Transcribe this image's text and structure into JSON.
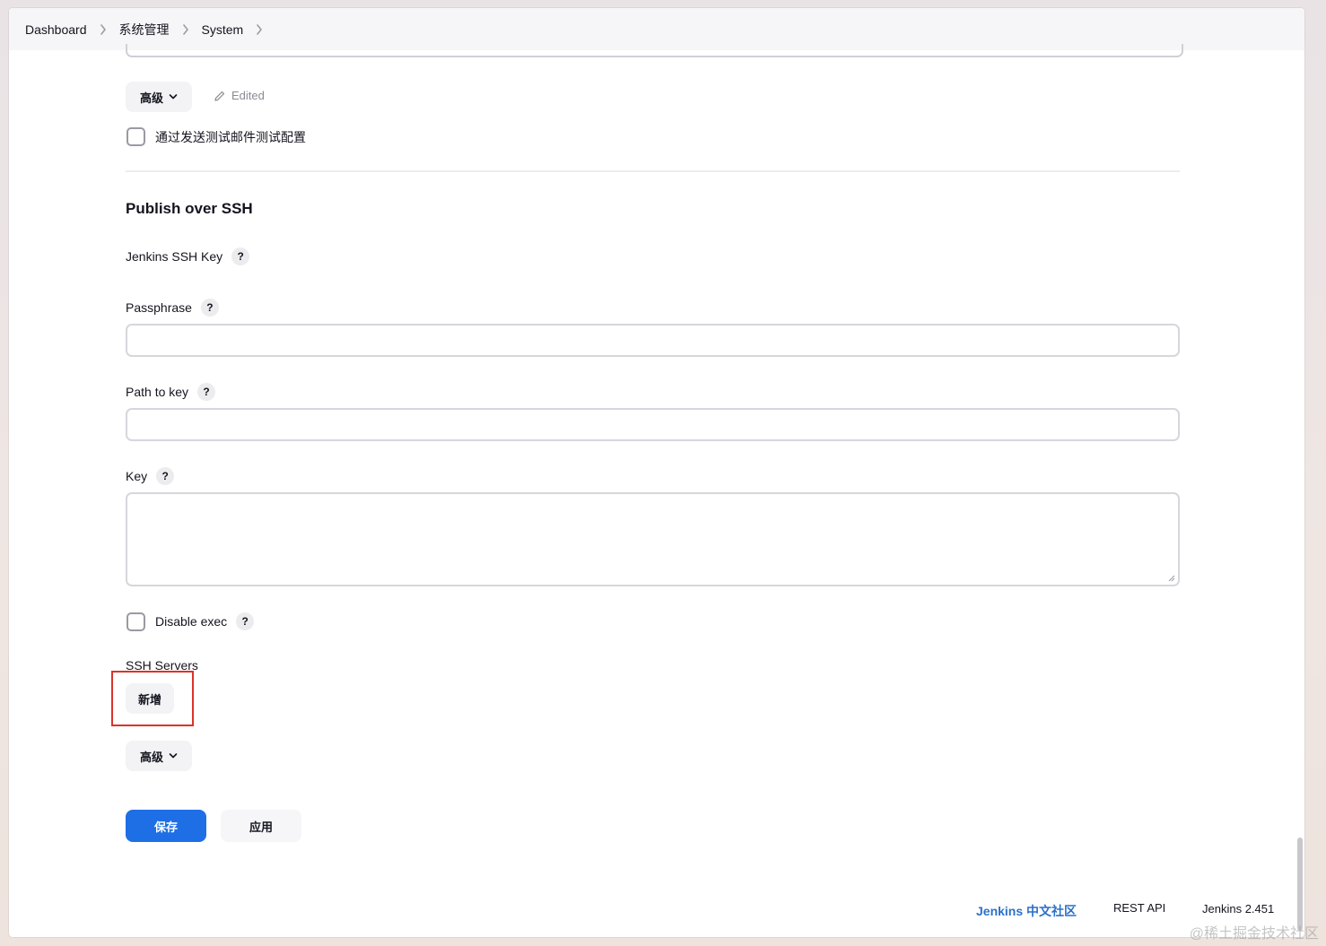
{
  "breadcrumb": {
    "items": [
      "Dashboard",
      "系统管理",
      "System"
    ]
  },
  "email_section": {
    "advanced_label": "高级",
    "edited_label": "Edited",
    "test_checkbox_label": "通过发送测试邮件测试配置"
  },
  "ssh_section": {
    "title": "Publish over SSH",
    "jenkins_ssh_key_label": "Jenkins SSH Key",
    "passphrase_label": "Passphrase",
    "passphrase_value": "",
    "path_to_key_label": "Path to key",
    "path_to_key_value": "",
    "key_label": "Key",
    "key_value": "",
    "disable_exec_label": "Disable exec",
    "ssh_servers_label": "SSH Servers",
    "add_button_label": "新增",
    "advanced_label": "高级",
    "help_glyph": "?"
  },
  "actions": {
    "save_label": "保存",
    "apply_label": "应用"
  },
  "footer": {
    "community_link": "Jenkins 中文社区",
    "rest_api": "REST API",
    "version": "Jenkins 2.451"
  },
  "watermark": "@稀土掘金技术社区",
  "colors": {
    "primary": "#1e6fe5",
    "link": "#2b71c9",
    "highlight": "#d9342b"
  }
}
